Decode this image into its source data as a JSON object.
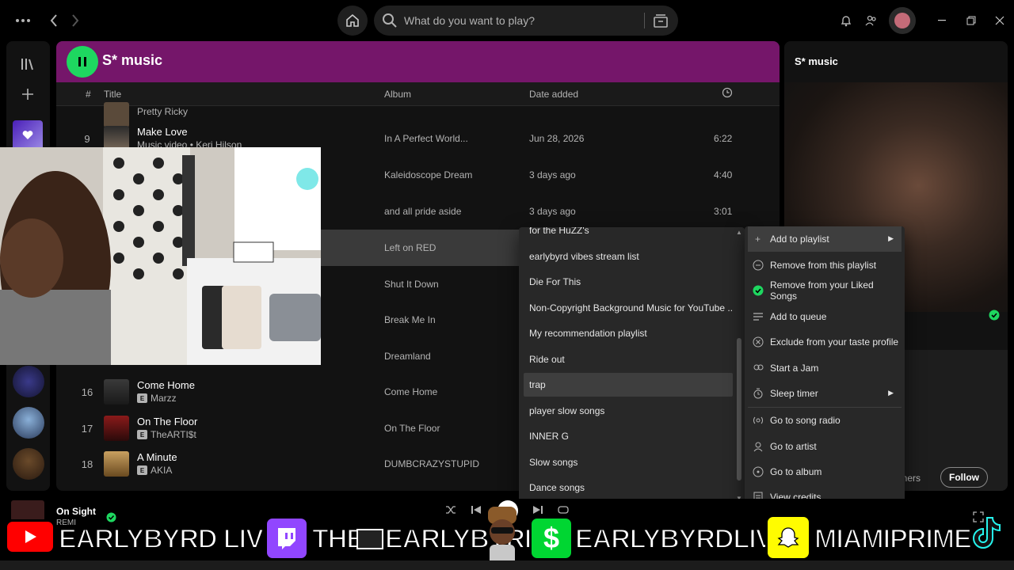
{
  "topbar": {
    "search_placeholder": "What do you want to play?"
  },
  "main": {
    "title": "S* music",
    "columns": {
      "num": "#",
      "title": "Title",
      "album": "Album",
      "date": "Date added"
    },
    "rows": [
      {
        "num": "",
        "title": "",
        "artist": "Pretty Ricky",
        "album": "",
        "date": "",
        "duration": ""
      },
      {
        "num": "9",
        "title": "Make Love",
        "artist": "Music video • Keri Hilson",
        "album": "In A Perfect World...",
        "date": "Jun 28, 2026",
        "duration": "6:22"
      },
      {
        "num": "",
        "title": "",
        "artist": "",
        "album": "Kaleidoscope Dream",
        "date": "3 days ago",
        "duration": "4:40"
      },
      {
        "num": "",
        "title": "",
        "artist": "",
        "album": "and all pride aside",
        "date": "3 days ago",
        "duration": "3:01"
      },
      {
        "num": "",
        "title": "",
        "artist": "",
        "album": "Left on RED",
        "date": "",
        "duration": ""
      },
      {
        "num": "",
        "title": "",
        "artist": "",
        "album": "Shut It Down",
        "date": "",
        "duration": ""
      },
      {
        "num": "",
        "title": "",
        "artist": "",
        "album": "Break Me In",
        "date": "",
        "duration": ""
      },
      {
        "num": "",
        "title": "",
        "artist": "",
        "album": "Dreamland",
        "date": "",
        "duration": ""
      },
      {
        "num": "16",
        "title": "Come Home",
        "artist": "Marzz",
        "album": "Come Home",
        "date": "",
        "duration": ""
      },
      {
        "num": "17",
        "title": "On The Floor",
        "artist": "TheARTI$t",
        "album": "On The Floor",
        "date": "",
        "duration": ""
      },
      {
        "num": "18",
        "title": "A Minute",
        "artist": "AKIA",
        "album": "DUMBCRAZYSTUPID",
        "date": "",
        "duration": ""
      }
    ]
  },
  "right_panel": {
    "title": "S* music",
    "followers_text": "oners",
    "follow_label": "Follow"
  },
  "playlist_submenu": {
    "items": [
      "for the HuZZ's",
      "earlybyrd vibes stream list",
      "Die For This",
      "Non-Copyright Background Music for YouTube ...",
      "My recommendation playlist",
      "Ride out",
      "trap",
      "player slow songs",
      "INNER G",
      "Slow songs",
      "Dance songs"
    ]
  },
  "context_menu": {
    "items": [
      {
        "label": "Add to playlist",
        "icon": "plus-icon",
        "submenu": true
      },
      {
        "label": "Remove from this playlist",
        "icon": "minus-circle-icon"
      },
      {
        "label": "Remove from your Liked Songs",
        "icon": "check-circle-icon"
      },
      {
        "label": "Add to queue",
        "icon": "queue-icon"
      },
      {
        "label": "Exclude from your taste profile",
        "icon": "exclude-icon"
      },
      {
        "label": "Start a Jam",
        "icon": "jam-icon"
      },
      {
        "label": "Sleep timer",
        "icon": "timer-icon",
        "submenu": true
      },
      {
        "label": "Go to song radio",
        "icon": "radio-icon"
      },
      {
        "label": "Go to artist",
        "icon": "artist-icon"
      },
      {
        "label": "Go to album",
        "icon": "album-icon"
      },
      {
        "label": "View credits",
        "icon": "credits-icon"
      }
    ]
  },
  "now_playing": {
    "title": "On Sight",
    "artist": "REMI"
  },
  "banner": {
    "youtube": "EARLYBYRD LIVE",
    "twitch_prefix": "THE",
    "twitch_suffix": "EARLYBYRD",
    "cashapp": "EARLYBYRDLIVE",
    "snapchat": "MIAMIPRIME"
  },
  "colors": {
    "accent_green": "#1ed760",
    "header_purple": "#75166a",
    "youtube_red": "#ff0000",
    "twitch_purple": "#9146ff",
    "cashapp_green": "#00d632",
    "snapchat_yellow": "#fffc00"
  }
}
